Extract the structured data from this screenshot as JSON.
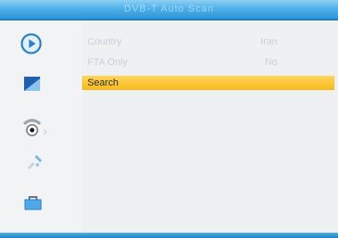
{
  "window": {
    "title": "DVB-T Auto Scan"
  },
  "sidebar": {
    "items": [
      {
        "icon": "play-icon"
      },
      {
        "icon": "picture-icon"
      },
      {
        "icon": "satellite-dish-icon"
      },
      {
        "icon": "tools-icon"
      },
      {
        "icon": "lock-icon"
      }
    ]
  },
  "menu": {
    "rows": [
      {
        "label": "Country",
        "value": "Iran"
      },
      {
        "label": "FTA Only",
        "value": "No"
      },
      {
        "label": "Search"
      }
    ]
  },
  "colors": {
    "title_bar": "#3aa5e4",
    "highlight": "#f9c22f",
    "dim_text": "#c8d0dc"
  }
}
